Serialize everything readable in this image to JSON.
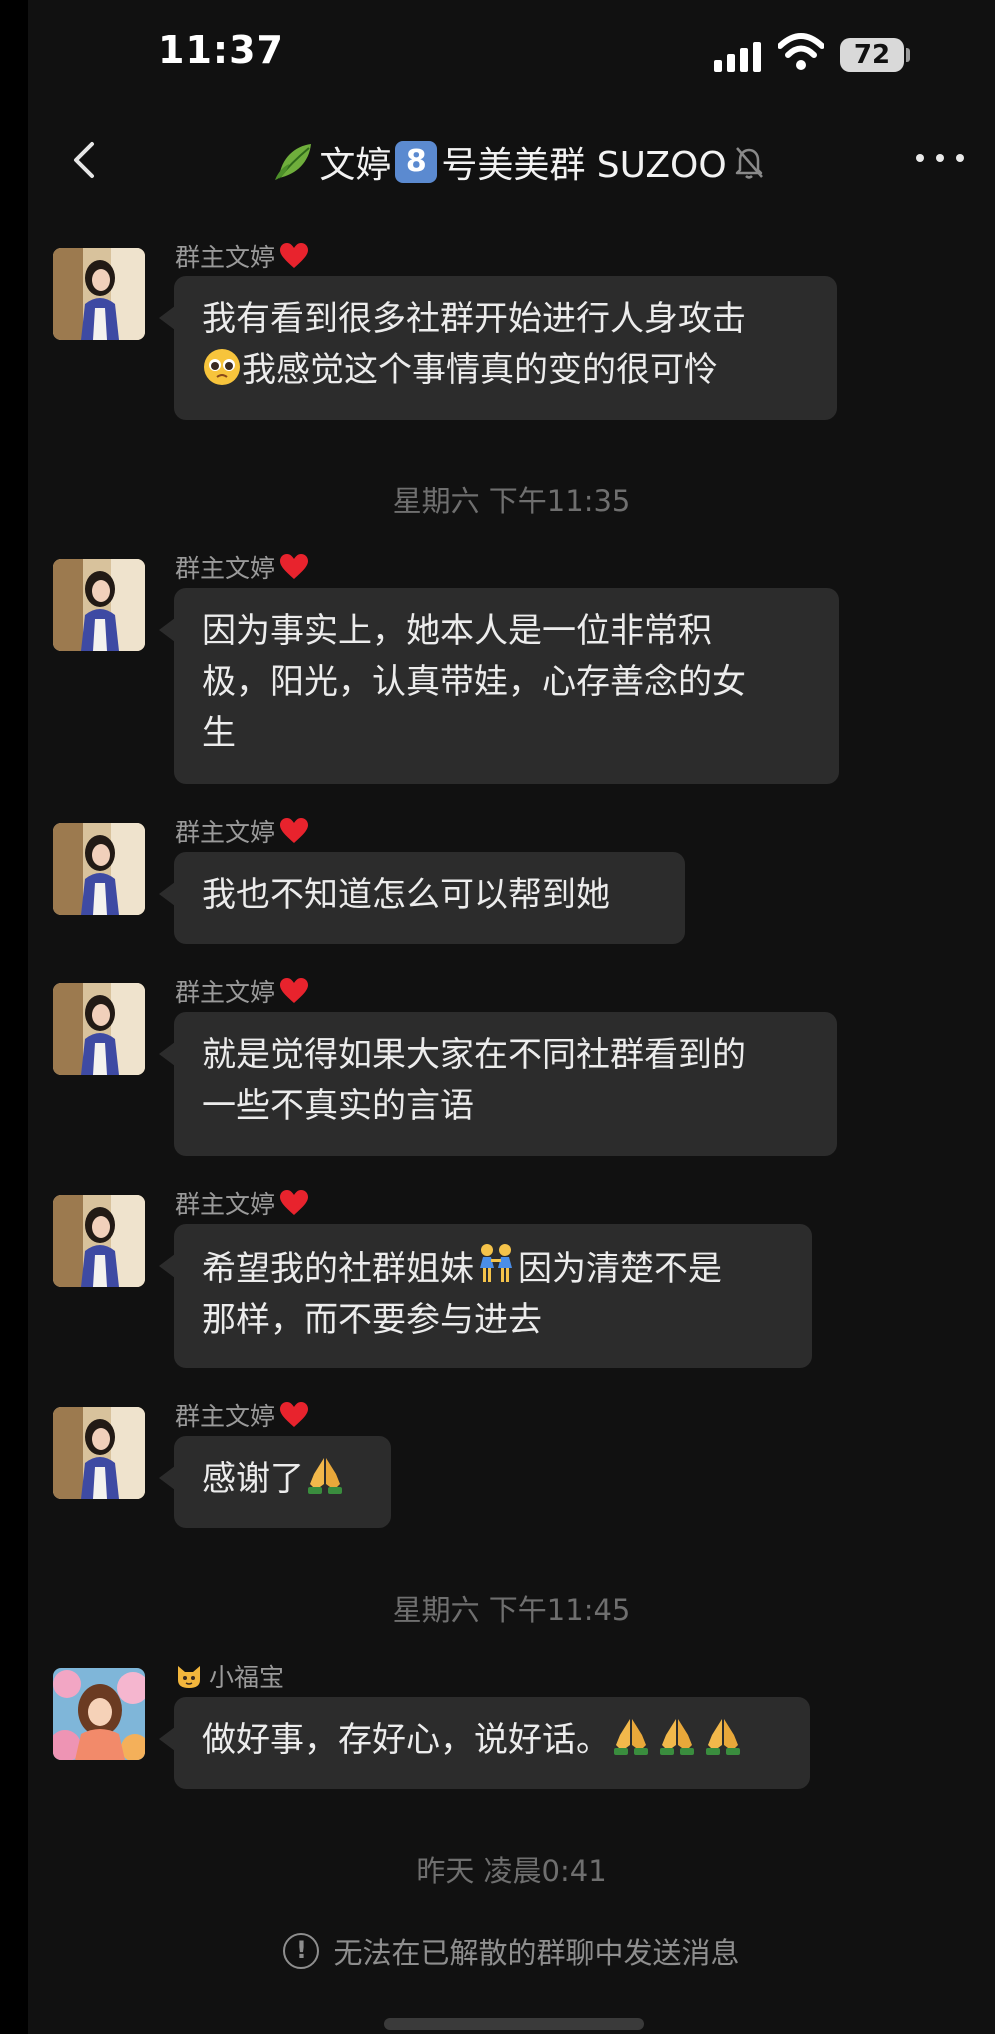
{
  "status_bar": {
    "time": "11:37",
    "battery": "72"
  },
  "nav": {
    "title_prefix": "文婷",
    "title_badge": "8",
    "title_suffix": "号美美群 SUZOO"
  },
  "messages": [
    {
      "sender": "群主文婷",
      "lines": [
        "我有看到很多社群开始进行人身攻击",
        "我感觉这个事情真的变的很可怜"
      ]
    },
    {
      "timestamp": "星期六 下午11:35"
    },
    {
      "sender": "群主文婷",
      "lines": [
        "因为事实上，她本人是一位非常积",
        "极，阳光，认真带娃，心存善念的女",
        "生"
      ]
    },
    {
      "sender": "群主文婷",
      "lines": [
        "我也不知道怎么可以帮到她"
      ]
    },
    {
      "sender": "群主文婷",
      "lines": [
        "就是觉得如果大家在不同社群看到的",
        "一些不真实的言语"
      ]
    },
    {
      "sender": "群主文婷",
      "lines": [
        "希望我的社群姐妹",
        "因为清楚不是",
        "那样，而不要参与进去"
      ]
    },
    {
      "sender": "群主文婷",
      "lines": [
        "感谢了"
      ]
    },
    {
      "timestamp": "星期六 下午11:45"
    },
    {
      "sender": "小福宝",
      "lines": [
        "做好事，存好心，说好话。"
      ]
    },
    {
      "timestamp": "昨天 凌晨0:41"
    }
  ],
  "notice": {
    "icon": "!",
    "text": "无法在已解散的群聊中发送消息"
  },
  "icons": {
    "status": [
      "cellular-signal-icon",
      "wifi-icon",
      "battery-icon"
    ],
    "nav": [
      "back-chevron-icon",
      "leaf-emoji-icon",
      "keycap-8-emoji-icon",
      "mute-bell-icon",
      "more-dots-icon"
    ],
    "message": [
      "heart-emoji-icon",
      "pleading-face-emoji-icon",
      "two-women-emoji-icon",
      "folded-hands-emoji-icon",
      "cat-face-emoji-icon"
    ]
  },
  "colors": {
    "background": "#111111",
    "bubble": "#2c2c2c",
    "text": "#ececec",
    "meta": "#9a9a9a",
    "heart": "#e8232d",
    "keycap": "#5b8ad0"
  }
}
